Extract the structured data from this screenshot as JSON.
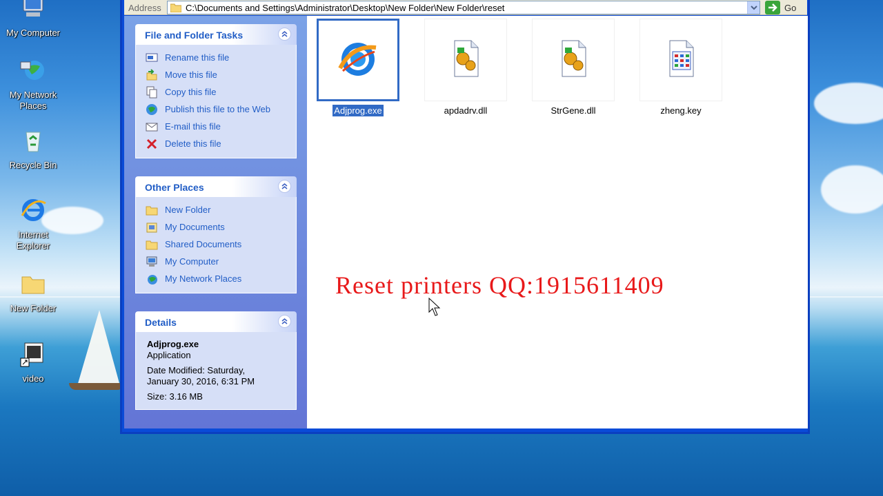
{
  "desktop": {
    "icons": [
      {
        "label": "My Computer",
        "icon": "my-computer-icon"
      },
      {
        "label": "My Network Places",
        "icon": "network-places-icon"
      },
      {
        "label": "Recycle Bin",
        "icon": "recycle-bin-icon"
      },
      {
        "label": "Internet Explorer",
        "icon": "internet-explorer-icon"
      },
      {
        "label": "New Folder",
        "icon": "folder-icon"
      },
      {
        "label": "video",
        "icon": "video-shortcut-icon"
      }
    ]
  },
  "address_bar": {
    "label": "Address",
    "path": "C:\\Documents and Settings\\Administrator\\Desktop\\New Folder\\New Folder\\reset",
    "go_label": "Go"
  },
  "task_pane": {
    "file_tasks": {
      "title": "File and Folder Tasks",
      "items": [
        {
          "label": "Rename this file",
          "icon": "rename-icon"
        },
        {
          "label": "Move this file",
          "icon": "move-icon"
        },
        {
          "label": "Copy this file",
          "icon": "copy-icon"
        },
        {
          "label": "Publish this file to the Web",
          "icon": "publish-web-icon"
        },
        {
          "label": "E-mail this file",
          "icon": "email-icon"
        },
        {
          "label": "Delete this file",
          "icon": "delete-icon"
        }
      ]
    },
    "other_places": {
      "title": "Other Places",
      "items": [
        {
          "label": "New Folder",
          "icon": "folder-icon"
        },
        {
          "label": "My Documents",
          "icon": "my-documents-icon"
        },
        {
          "label": "Shared Documents",
          "icon": "shared-folder-icon"
        },
        {
          "label": "My Computer",
          "icon": "my-computer-icon"
        },
        {
          "label": "My Network Places",
          "icon": "network-places-icon"
        }
      ]
    },
    "details": {
      "title": "Details",
      "name": "Adjprog.exe",
      "type": "Application",
      "modified_line1": "Date Modified: Saturday,",
      "modified_line2": "January 30, 2016, 6:31 PM",
      "size": "Size: 3.16 MB"
    }
  },
  "files": [
    {
      "name": "Adjprog.exe",
      "icon": "exe-app-icon",
      "selected": true
    },
    {
      "name": "apdadrv.dll",
      "icon": "dll-file-icon",
      "selected": false
    },
    {
      "name": "StrGene.dll",
      "icon": "dll-file-icon",
      "selected": false
    },
    {
      "name": "zheng.key",
      "icon": "key-file-icon",
      "selected": false
    }
  ],
  "overlay_text": "Reset printers QQ:1915611409",
  "colors": {
    "link_blue": "#215dc6",
    "selection_blue": "#316ac5",
    "overlay_red": "#e8191a",
    "window_blue": "#0a4bd8"
  }
}
